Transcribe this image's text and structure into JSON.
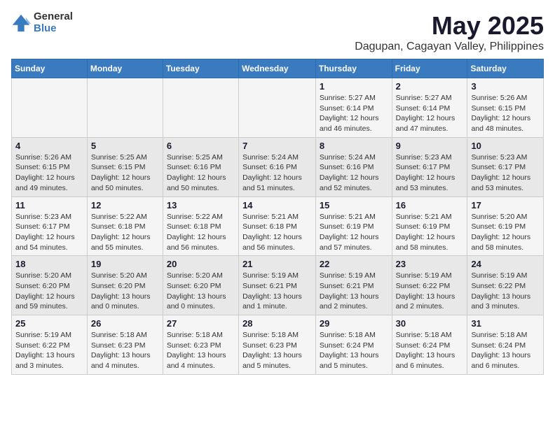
{
  "logo": {
    "general": "General",
    "blue": "Blue"
  },
  "header": {
    "title": "May 2025",
    "subtitle": "Dagupan, Cagayan Valley, Philippines"
  },
  "days_of_week": [
    "Sunday",
    "Monday",
    "Tuesday",
    "Wednesday",
    "Thursday",
    "Friday",
    "Saturday"
  ],
  "weeks": [
    [
      {
        "day": "",
        "info": ""
      },
      {
        "day": "",
        "info": ""
      },
      {
        "day": "",
        "info": ""
      },
      {
        "day": "",
        "info": ""
      },
      {
        "day": "1",
        "info": "Sunrise: 5:27 AM\nSunset: 6:14 PM\nDaylight: 12 hours and 46 minutes."
      },
      {
        "day": "2",
        "info": "Sunrise: 5:27 AM\nSunset: 6:14 PM\nDaylight: 12 hours and 47 minutes."
      },
      {
        "day": "3",
        "info": "Sunrise: 5:26 AM\nSunset: 6:15 PM\nDaylight: 12 hours and 48 minutes."
      }
    ],
    [
      {
        "day": "4",
        "info": "Sunrise: 5:26 AM\nSunset: 6:15 PM\nDaylight: 12 hours and 49 minutes."
      },
      {
        "day": "5",
        "info": "Sunrise: 5:25 AM\nSunset: 6:15 PM\nDaylight: 12 hours and 50 minutes."
      },
      {
        "day": "6",
        "info": "Sunrise: 5:25 AM\nSunset: 6:16 PM\nDaylight: 12 hours and 50 minutes."
      },
      {
        "day": "7",
        "info": "Sunrise: 5:24 AM\nSunset: 6:16 PM\nDaylight: 12 hours and 51 minutes."
      },
      {
        "day": "8",
        "info": "Sunrise: 5:24 AM\nSunset: 6:16 PM\nDaylight: 12 hours and 52 minutes."
      },
      {
        "day": "9",
        "info": "Sunrise: 5:23 AM\nSunset: 6:17 PM\nDaylight: 12 hours and 53 minutes."
      },
      {
        "day": "10",
        "info": "Sunrise: 5:23 AM\nSunset: 6:17 PM\nDaylight: 12 hours and 53 minutes."
      }
    ],
    [
      {
        "day": "11",
        "info": "Sunrise: 5:23 AM\nSunset: 6:17 PM\nDaylight: 12 hours and 54 minutes."
      },
      {
        "day": "12",
        "info": "Sunrise: 5:22 AM\nSunset: 6:18 PM\nDaylight: 12 hours and 55 minutes."
      },
      {
        "day": "13",
        "info": "Sunrise: 5:22 AM\nSunset: 6:18 PM\nDaylight: 12 hours and 56 minutes."
      },
      {
        "day": "14",
        "info": "Sunrise: 5:21 AM\nSunset: 6:18 PM\nDaylight: 12 hours and 56 minutes."
      },
      {
        "day": "15",
        "info": "Sunrise: 5:21 AM\nSunset: 6:19 PM\nDaylight: 12 hours and 57 minutes."
      },
      {
        "day": "16",
        "info": "Sunrise: 5:21 AM\nSunset: 6:19 PM\nDaylight: 12 hours and 58 minutes."
      },
      {
        "day": "17",
        "info": "Sunrise: 5:20 AM\nSunset: 6:19 PM\nDaylight: 12 hours and 58 minutes."
      }
    ],
    [
      {
        "day": "18",
        "info": "Sunrise: 5:20 AM\nSunset: 6:20 PM\nDaylight: 12 hours and 59 minutes."
      },
      {
        "day": "19",
        "info": "Sunrise: 5:20 AM\nSunset: 6:20 PM\nDaylight: 13 hours and 0 minutes."
      },
      {
        "day": "20",
        "info": "Sunrise: 5:20 AM\nSunset: 6:20 PM\nDaylight: 13 hours and 0 minutes."
      },
      {
        "day": "21",
        "info": "Sunrise: 5:19 AM\nSunset: 6:21 PM\nDaylight: 13 hours and 1 minute."
      },
      {
        "day": "22",
        "info": "Sunrise: 5:19 AM\nSunset: 6:21 PM\nDaylight: 13 hours and 2 minutes."
      },
      {
        "day": "23",
        "info": "Sunrise: 5:19 AM\nSunset: 6:22 PM\nDaylight: 13 hours and 2 minutes."
      },
      {
        "day": "24",
        "info": "Sunrise: 5:19 AM\nSunset: 6:22 PM\nDaylight: 13 hours and 3 minutes."
      }
    ],
    [
      {
        "day": "25",
        "info": "Sunrise: 5:19 AM\nSunset: 6:22 PM\nDaylight: 13 hours and 3 minutes."
      },
      {
        "day": "26",
        "info": "Sunrise: 5:18 AM\nSunset: 6:23 PM\nDaylight: 13 hours and 4 minutes."
      },
      {
        "day": "27",
        "info": "Sunrise: 5:18 AM\nSunset: 6:23 PM\nDaylight: 13 hours and 4 minutes."
      },
      {
        "day": "28",
        "info": "Sunrise: 5:18 AM\nSunset: 6:23 PM\nDaylight: 13 hours and 5 minutes."
      },
      {
        "day": "29",
        "info": "Sunrise: 5:18 AM\nSunset: 6:24 PM\nDaylight: 13 hours and 5 minutes."
      },
      {
        "day": "30",
        "info": "Sunrise: 5:18 AM\nSunset: 6:24 PM\nDaylight: 13 hours and 6 minutes."
      },
      {
        "day": "31",
        "info": "Sunrise: 5:18 AM\nSunset: 6:24 PM\nDaylight: 13 hours and 6 minutes."
      }
    ]
  ]
}
